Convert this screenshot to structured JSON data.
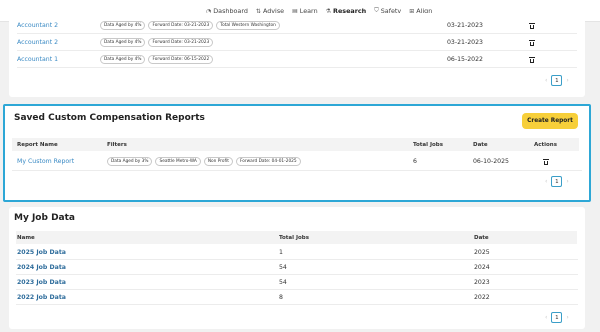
{
  "nav": {
    "items": [
      {
        "label": "Dashboard",
        "icon": "dashboard-icon",
        "glyph": "◔"
      },
      {
        "label": "Advise",
        "icon": "advise-icon",
        "glyph": "⇅"
      },
      {
        "label": "Learn",
        "icon": "learn-icon",
        "glyph": "▤"
      },
      {
        "label": "Research",
        "icon": "research-icon",
        "glyph": "⚗"
      },
      {
        "label": "Safety",
        "icon": "safety-icon",
        "glyph": "⛉"
      },
      {
        "label": "Align",
        "icon": "align-icon",
        "glyph": "⊞"
      }
    ],
    "active": "Research"
  },
  "top_table": {
    "rows": [
      {
        "name": "Accountant 2",
        "filters": [
          "Data Aged by 4%",
          "Forward Date: 03-21-2023",
          "Total Western Washington"
        ],
        "date": "03-21-2023"
      },
      {
        "name": "Accountant 2",
        "filters": [
          "Data Aged by 4%",
          "Forward Date: 03-21-2023"
        ],
        "date": "03-21-2023"
      },
      {
        "name": "Accountant 1",
        "filters": [
          "Data Aged by 4%",
          "Forward Date: 06-15-2022"
        ],
        "date": "06-15-2022"
      }
    ],
    "page": "1"
  },
  "saved_reports": {
    "title": "Saved Custom Compensation Reports",
    "create_label": "Create Report",
    "headers": {
      "name": "Report Name",
      "filters": "Filters",
      "total": "Total Jobs",
      "date": "Date",
      "actions": "Actions"
    },
    "rows": [
      {
        "name": "My Custom Report",
        "filters": [
          "Data Aged by 3%",
          "Seattle Metro-WA",
          "Non Profit",
          "Forward Date: 04-01-2025"
        ],
        "total": "6",
        "date": "06-10-2025"
      }
    ],
    "page": "1"
  },
  "job_data": {
    "title": "My Job Data",
    "headers": {
      "name": "Name",
      "total": "Total Jobs",
      "date": "Date"
    },
    "rows": [
      {
        "name": "2025 Job Data",
        "total": "1",
        "date": "2025"
      },
      {
        "name": "2024 Job Data",
        "total": "54",
        "date": "2024"
      },
      {
        "name": "2023 Job Data",
        "total": "54",
        "date": "2023"
      },
      {
        "name": "2022 Job Data",
        "total": "8",
        "date": "2022"
      }
    ],
    "page": "1"
  },
  "pager": {
    "prev": "‹",
    "next": "›"
  },
  "colors": {
    "accent": "#2da7d6",
    "button": "#f7cf3a",
    "link": "#3a8ac4"
  }
}
